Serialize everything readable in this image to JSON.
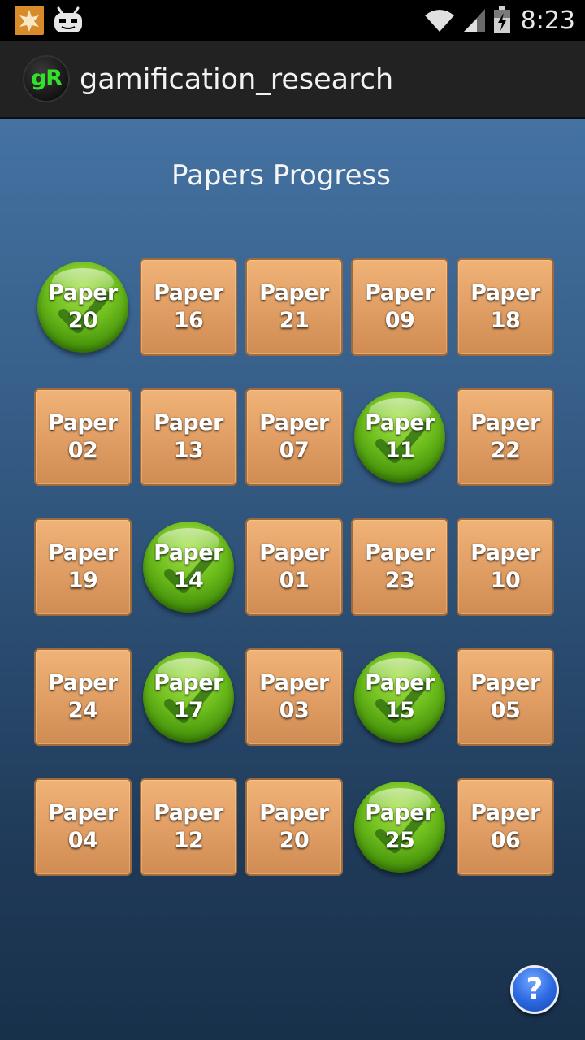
{
  "status_bar": {
    "time": "8:23",
    "icons": [
      "notification-star-icon",
      "android-robot-icon",
      "wifi-icon",
      "signal-icon",
      "battery-charging-icon"
    ]
  },
  "action_bar": {
    "logo_text": "gR",
    "title": "gamification_research"
  },
  "main": {
    "title": "Papers Progress",
    "papers": [
      {
        "label": "Paper",
        "number": "20",
        "completed": true
      },
      {
        "label": "Paper",
        "number": "16",
        "completed": false
      },
      {
        "label": "Paper",
        "number": "21",
        "completed": false
      },
      {
        "label": "Paper",
        "number": "09",
        "completed": false
      },
      {
        "label": "Paper",
        "number": "18",
        "completed": false
      },
      {
        "label": "Paper",
        "number": "02",
        "completed": false
      },
      {
        "label": "Paper",
        "number": "13",
        "completed": false
      },
      {
        "label": "Paper",
        "number": "07",
        "completed": false
      },
      {
        "label": "Paper",
        "number": "11",
        "completed": true
      },
      {
        "label": "Paper",
        "number": "22",
        "completed": false
      },
      {
        "label": "Paper",
        "number": "19",
        "completed": false
      },
      {
        "label": "Paper",
        "number": "14",
        "completed": true
      },
      {
        "label": "Paper",
        "number": "01",
        "completed": false
      },
      {
        "label": "Paper",
        "number": "23",
        "completed": false
      },
      {
        "label": "Paper",
        "number": "10",
        "completed": false
      },
      {
        "label": "Paper",
        "number": "24",
        "completed": false
      },
      {
        "label": "Paper",
        "number": "17",
        "completed": true
      },
      {
        "label": "Paper",
        "number": "03",
        "completed": false
      },
      {
        "label": "Paper",
        "number": "15",
        "completed": true
      },
      {
        "label": "Paper",
        "number": "05",
        "completed": false
      },
      {
        "label": "Paper",
        "number": "04",
        "completed": false
      },
      {
        "label": "Paper",
        "number": "12",
        "completed": false
      },
      {
        "label": "Paper",
        "number": "20",
        "completed": false
      },
      {
        "label": "Paper",
        "number": "25",
        "completed": true
      },
      {
        "label": "Paper",
        "number": "06",
        "completed": false
      }
    ],
    "help_label": "?"
  },
  "colors": {
    "tile": "#e3a167",
    "completed": "#6cbc1c",
    "background_top": "#4472a2",
    "background_bottom": "#18304a",
    "logo_text": "#33e02a"
  }
}
